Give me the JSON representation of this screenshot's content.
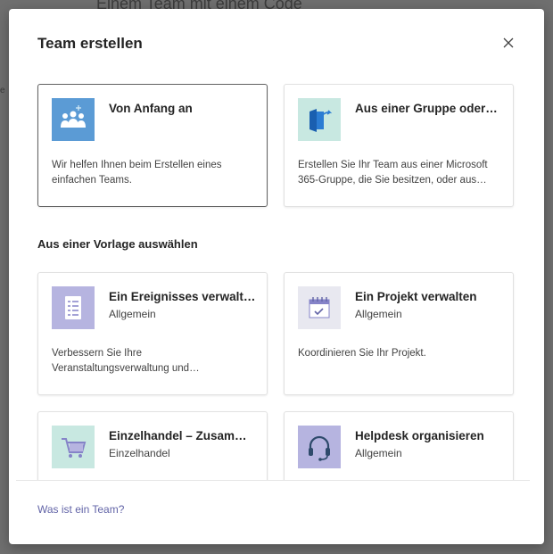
{
  "background": {
    "heading": "Einem Team mit einem Code"
  },
  "dialog": {
    "title": "Team erstellen",
    "close_icon": "close-icon",
    "cards_top": [
      {
        "title": "Von Anfang an",
        "description": "Wir helfen Ihnen beim Erstellen eines einfachen Teams.",
        "icon": "team-people-icon"
      },
      {
        "title": "Aus einer Gruppe oder…",
        "description": "Erstellen Sie Ihr Team aus einer Microsoft 365-Gruppe, die Sie besitzen, oder aus…",
        "icon": "group-import-icon"
      }
    ],
    "section_title": "Aus einer Vorlage auswählen",
    "templates": [
      {
        "title": "Ein Ereignisses verwalt…",
        "category": "Allgemein",
        "description": "Verbessern Sie Ihre Veranstaltungsverwaltung und…",
        "icon": "checklist-icon"
      },
      {
        "title": "Ein Projekt verwalten",
        "category": "Allgemein",
        "description": "Koordinieren Sie Ihr Projekt.",
        "icon": "calendar-check-icon"
      },
      {
        "title": "Einzelhandel – Zusam…",
        "category": "Einzelhandel",
        "description": "",
        "icon": "shopping-cart-icon"
      },
      {
        "title": "Helpdesk organisieren",
        "category": "Allgemein",
        "description": "",
        "icon": "headset-icon"
      }
    ],
    "footer_link": "Was ist ein Team?"
  },
  "colors": {
    "accent": "#6264a7",
    "team_icon_bg": "#5b9bd5",
    "teal_bg": "#c8e8e1",
    "lavender_bg": "#b6b4e0"
  }
}
